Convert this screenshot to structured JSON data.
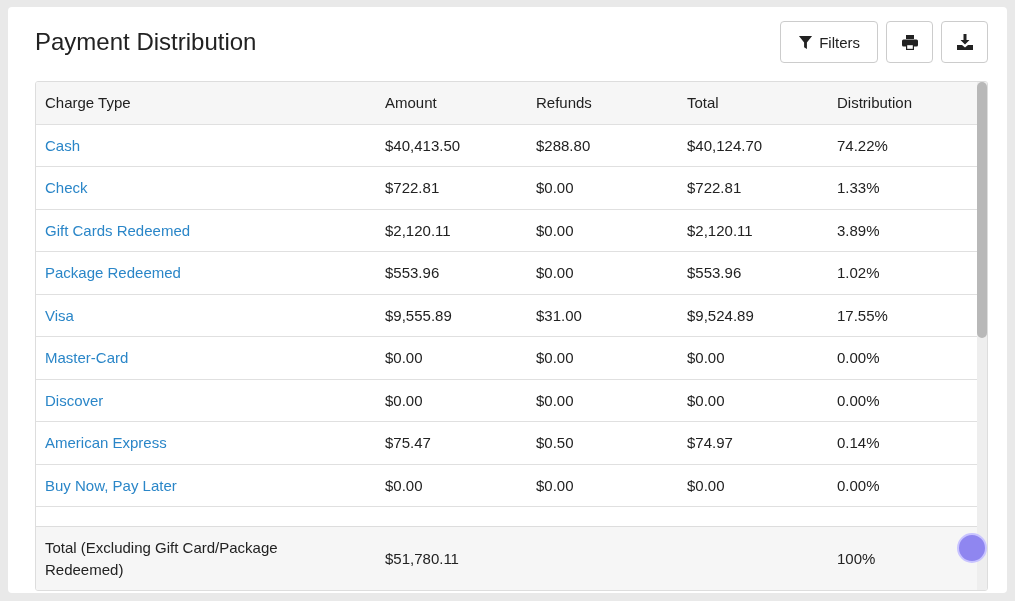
{
  "title": "Payment Distribution",
  "toolbar": {
    "filters_label": "Filters"
  },
  "table": {
    "columns": [
      "Charge Type",
      "Amount",
      "Refunds",
      "Total",
      "Distribution"
    ],
    "rows": [
      [
        "Cash",
        "$40,413.50",
        "$288.80",
        "$40,124.70",
        "74.22%"
      ],
      [
        "Check",
        "$722.81",
        "$0.00",
        "$722.81",
        "1.33%"
      ],
      [
        "Gift Cards Redeemed",
        "$2,120.11",
        "$0.00",
        "$2,120.11",
        "3.89%"
      ],
      [
        "Package Redeemed",
        "$553.96",
        "$0.00",
        "$553.96",
        "1.02%"
      ],
      [
        "Visa",
        "$9,555.89",
        "$31.00",
        "$9,524.89",
        "17.55%"
      ],
      [
        "Master-Card",
        "$0.00",
        "$0.00",
        "$0.00",
        "0.00%"
      ],
      [
        "Discover",
        "$0.00",
        "$0.00",
        "$0.00",
        "0.00%"
      ],
      [
        "American Express",
        "$75.47",
        "$0.50",
        "$74.97",
        "0.14%"
      ],
      [
        "Buy Now, Pay Later",
        "$0.00",
        "$0.00",
        "$0.00",
        "0.00%"
      ]
    ],
    "footer": {
      "label": "Total (Excluding Gift Card/Package Redeemed)",
      "amount": "$51,780.11",
      "distribution": "100%"
    }
  }
}
